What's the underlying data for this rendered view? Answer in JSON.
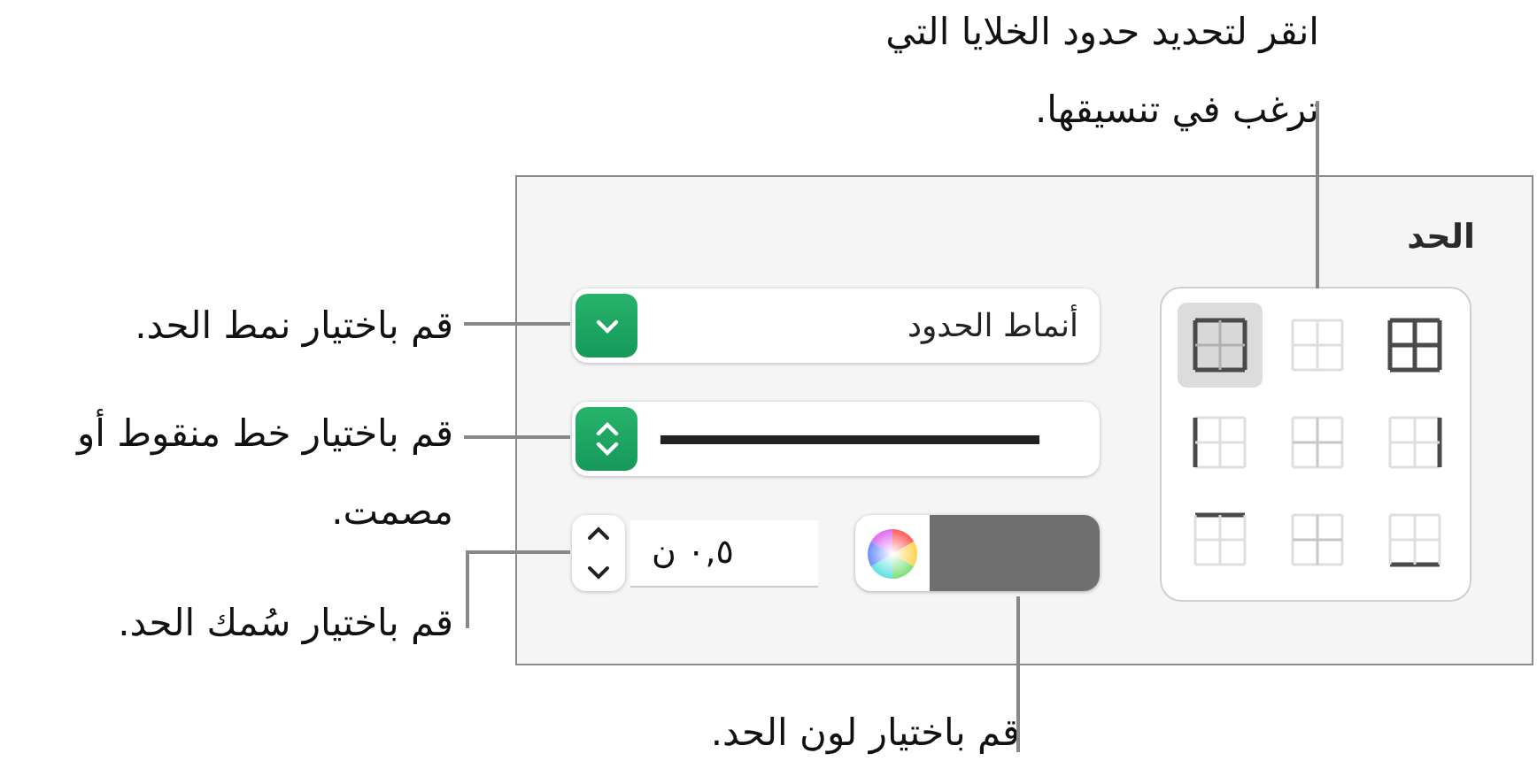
{
  "callouts": [
    {
      "text": "انقر لتحديد حدود الخلايا التي ترغب في تنسيقها."
    },
    {
      "text": "قم باختيار نمط الحد."
    },
    {
      "text": "قم باختيار خط منقوط أو مصمت."
    },
    {
      "text": "قم باختيار سُمك الحد."
    },
    {
      "text": "قم باختيار لون الحد."
    }
  ],
  "panel": {
    "title": "الحد",
    "border_presets": [
      {
        "kind": "outer",
        "selected": true
      },
      {
        "kind": "none",
        "selected": false
      },
      {
        "kind": "all",
        "selected": false
      },
      {
        "kind": "left",
        "selected": false
      },
      {
        "kind": "inside-v",
        "selected": false
      },
      {
        "kind": "right",
        "selected": false
      },
      {
        "kind": "top",
        "selected": false
      },
      {
        "kind": "inside-h",
        "selected": false
      },
      {
        "kind": "bottom",
        "selected": false
      }
    ],
    "style_menu": {
      "label": "أنماط الحدود"
    },
    "width_field": {
      "value": "٠,٥ ن"
    }
  }
}
